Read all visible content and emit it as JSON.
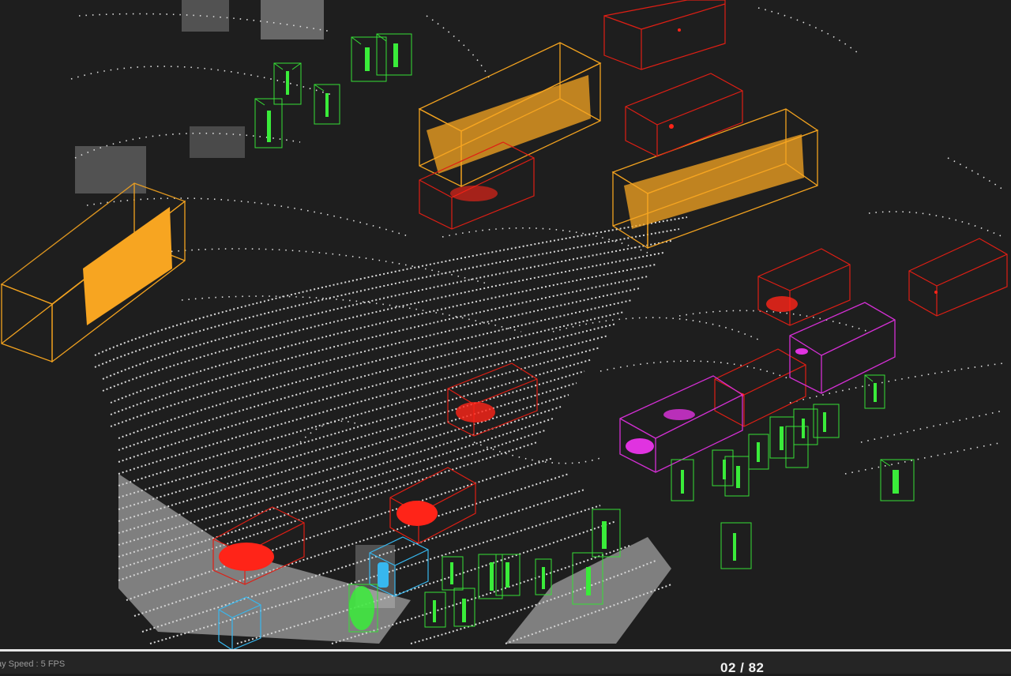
{
  "footer": {
    "speed_label": "ay Speed : 5 FPS",
    "frame_counter": "02 / 82"
  },
  "colors": {
    "background": "#1e1e1e",
    "ground_points": "#d8d8d8",
    "car": "#ff2a1a",
    "bus_truck": "#f7a521",
    "pedestrian": "#3aec3a",
    "cyclist": "#e033e0",
    "unknown": "#37b7ee"
  },
  "scene": {
    "object_classes": [
      {
        "name": "car",
        "color_key": "car",
        "count": 11
      },
      {
        "name": "bus",
        "color_key": "bus_truck",
        "count": 3
      },
      {
        "name": "pedestrian",
        "color_key": "pedestrian",
        "count": 30
      },
      {
        "name": "cyclist",
        "color_key": "cyclist",
        "count": 2
      },
      {
        "name": "unknown",
        "color_key": "unknown",
        "count": 2
      }
    ]
  }
}
